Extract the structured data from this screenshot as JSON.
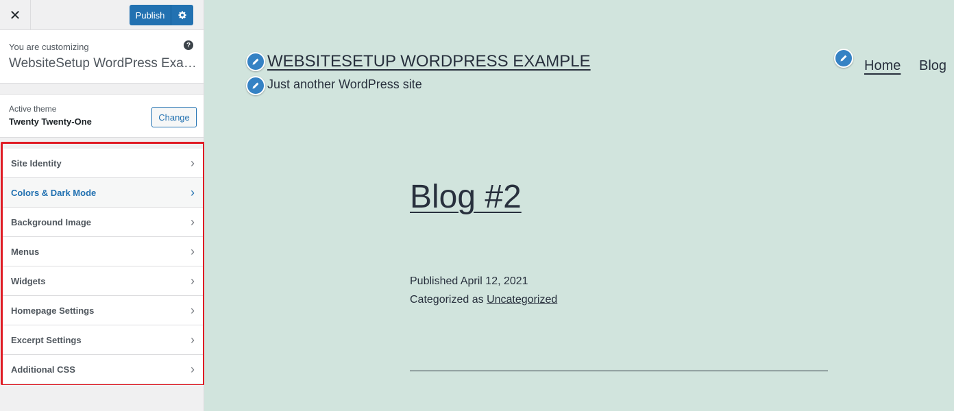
{
  "sidebar": {
    "close_icon": "close-icon",
    "publish_label": "Publish",
    "publish_settings_icon": "gear-icon",
    "customizing_label": "You are customizing",
    "site_name_truncated": "WebsiteSetup WordPress Exa…",
    "help_icon": "?",
    "active_theme_label": "Active theme",
    "theme_name": "Twenty Twenty-One",
    "change_label": "Change",
    "menu_items": [
      {
        "label": "Site Identity"
      },
      {
        "label": "Colors & Dark Mode"
      },
      {
        "label": "Background Image"
      },
      {
        "label": "Menus"
      },
      {
        "label": "Widgets"
      },
      {
        "label": "Homepage Settings"
      },
      {
        "label": "Excerpt Settings"
      },
      {
        "label": "Additional CSS"
      }
    ],
    "active_item_index": 1,
    "highlight_color": "#e01b24",
    "accent_color": "#2271b1"
  },
  "preview": {
    "site_title": "WEBSITESETUP WORDPRESS EXAMPLE",
    "tagline": "Just another WordPress site",
    "nav": {
      "home": "Home",
      "blog": "Blog"
    },
    "post_title": "Blog #2",
    "published": "Published April 12, 2021",
    "categorized_prefix": "Categorized as",
    "category": "Uncategorized",
    "edit_icon": "pencil-icon",
    "background_color": "#d1e4dd"
  }
}
